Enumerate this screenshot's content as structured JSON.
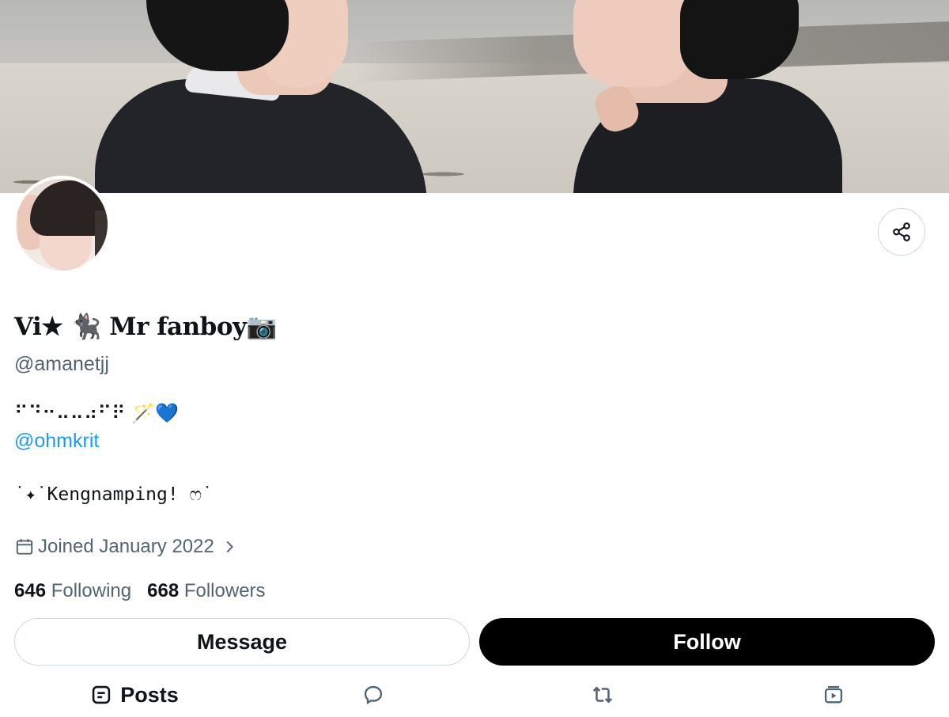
{
  "profile": {
    "display_name": "Vi★ 🐈‍⬛ Mr fanboy📷",
    "handle": "@amanetjj",
    "bio_line1": "⠋⠙⠒⠤⠤⠴⠋⠟ 🪄💙",
    "bio_mention": "@ohmkrit",
    "bio_line2": "˙✦˙Kengnamping! ෆ˙",
    "joined": "Joined January 2022",
    "following_count": "646",
    "following_label": "Following",
    "followers_count": "668",
    "followers_label": "Followers"
  },
  "actions": {
    "message_label": "Message",
    "follow_label": "Follow"
  },
  "tabs": {
    "posts_label": "Posts"
  },
  "icons": {
    "share": "share-icon",
    "calendar": "calendar-icon",
    "chevron": "chevron-right-icon",
    "posts": "posts-icon",
    "replies": "reply-icon",
    "reposts": "repost-icon",
    "media": "media-icon"
  },
  "colors": {
    "text": "#0f1419",
    "secondary": "#536471",
    "link": "#1d9bf0",
    "follow_bg": "#000000"
  }
}
